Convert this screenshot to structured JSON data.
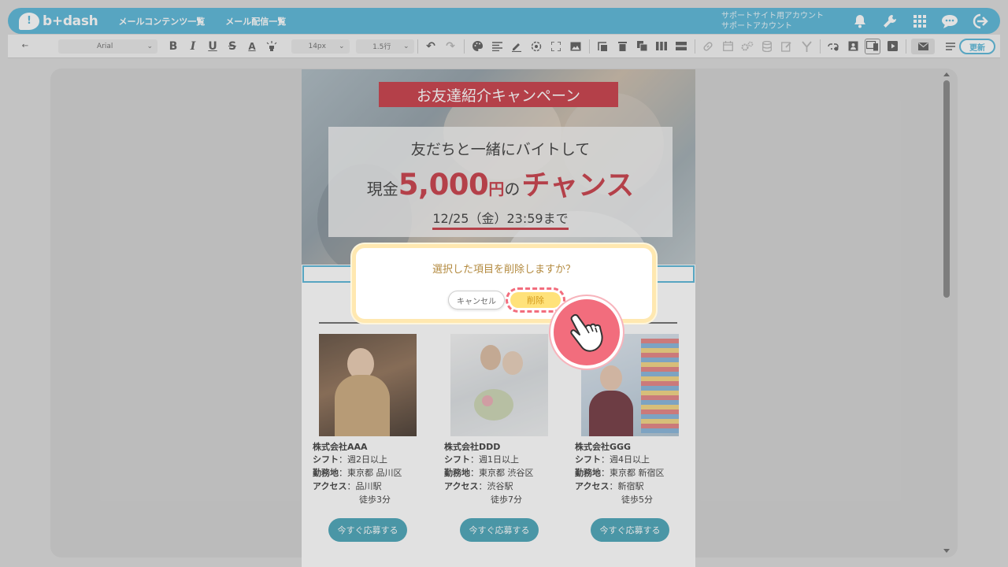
{
  "app": {
    "logo_text": "b+dash",
    "nav": [
      "メールコンテンツ一覧",
      "メール配信一覧"
    ],
    "account_line1": "サポートサイト用アカウント",
    "account_line2": "サポートアカウント",
    "top_icons": [
      "bell-icon",
      "wrench-icon",
      "grid-icon",
      "chat-icon",
      "logout-icon"
    ]
  },
  "toolbar": {
    "back_icon": "←",
    "font_family": "Arial",
    "font_size": "14px",
    "line_height": "1.5行",
    "update_label": "更新"
  },
  "hero": {
    "banner": "お友達紹介キャンペーン",
    "line1": "友だちと一緒にバイトして",
    "cash_prefix": "現金",
    "amount": "5,000",
    "yen": "円",
    "no": "の",
    "chance": "チャンス",
    "deadline": "12/25（金）23:59まで"
  },
  "jobs": [
    {
      "company": "株式会社AAA",
      "shift_label": "シフト",
      "shift": "：週2日以上",
      "location_label": "勤務地",
      "location": "：東京都 品川区",
      "access_label": "アクセス",
      "access": "：品川駅",
      "walk": "徒歩3分",
      "button": "今すぐ応募する"
    },
    {
      "company": "株式会社DDD",
      "shift_label": "シフト",
      "shift": "：週1日以上",
      "location_label": "勤務地",
      "location": "：東京都 渋谷区",
      "access_label": "アクセス",
      "access": "：渋谷駅",
      "walk": "徒歩7分",
      "button": "今すぐ応募する"
    },
    {
      "company": "株式会社GGG",
      "shift_label": "シフト",
      "shift": "：週4日以上",
      "location_label": "勤務地",
      "location": "：東京都 新宿区",
      "access_label": "アクセス",
      "access": "：新宿駅",
      "walk": "徒歩5分",
      "button": "今すぐ応募する"
    }
  ],
  "dialog": {
    "message": "選択した項目を削除しますか？",
    "cancel": "キャンセル",
    "delete": "削除"
  },
  "colors": {
    "brand": "#4fb3d6",
    "accent_red": "#c6313d",
    "button_teal": "#3e9fb4",
    "highlight_pink": "#f26d7d",
    "delete_yellow": "#ffe27a"
  }
}
